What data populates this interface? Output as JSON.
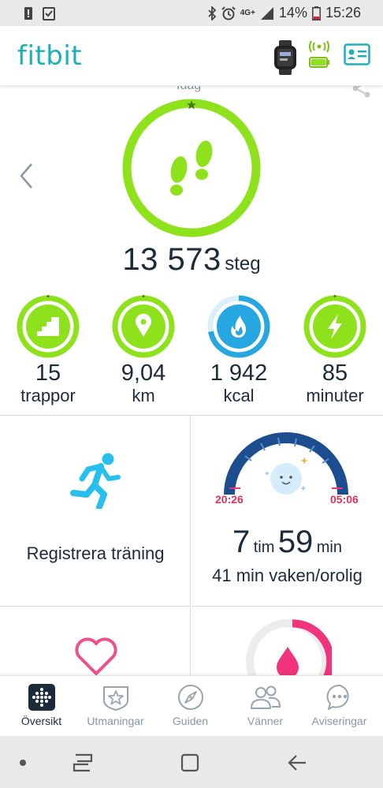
{
  "status_bar": {
    "network": "4G+",
    "battery_percent": "14%",
    "time": "15:26"
  },
  "header": {
    "logo": "fitbit"
  },
  "dashboard": {
    "day_label": "Idag",
    "steps": {
      "value": "13 573",
      "unit": "steg",
      "goal_progress": 1.0
    },
    "stats": [
      {
        "value": "15",
        "label": "trappor",
        "icon": "stairs-icon",
        "progress": 1.0
      },
      {
        "value": "9,04",
        "label": "km",
        "icon": "location-pin-icon",
        "progress": 1.0
      },
      {
        "value": "1 942",
        "label": "kcal",
        "icon": "flame-icon",
        "progress": 0.72
      },
      {
        "value": "85",
        "label": "minuter",
        "icon": "lightning-icon",
        "progress": 1.0
      }
    ]
  },
  "tiles": {
    "exercise": {
      "label": "Registrera träning"
    },
    "sleep": {
      "start": "20:26",
      "end": "05:06",
      "hours": "7",
      "hours_unit": "tim",
      "minutes": "59",
      "minutes_unit": "min",
      "awake": "41 min vaken/orolig"
    }
  },
  "bottom_nav": [
    {
      "label": "Översikt",
      "icon": "dashboard-icon",
      "active": true
    },
    {
      "label": "Utmaningar",
      "icon": "challenges-icon",
      "active": false
    },
    {
      "label": "Guiden",
      "icon": "compass-icon",
      "active": false
    },
    {
      "label": "Vänner",
      "icon": "friends-icon",
      "active": false
    },
    {
      "label": "Aviseringar",
      "icon": "notifications-icon",
      "active": false
    }
  ],
  "colors": {
    "green": "#8ee21c",
    "teal": "#1bb0b8",
    "blue": "#27a7e2",
    "sleep_blue": "#1c4d8e",
    "pink": "#f0337a",
    "text": "#1c2b39"
  }
}
